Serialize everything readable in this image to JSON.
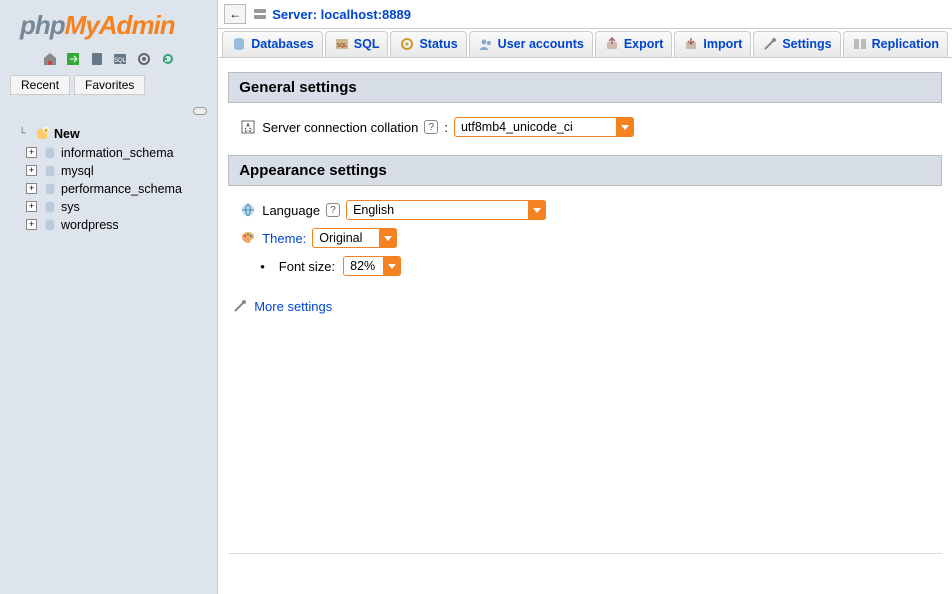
{
  "server": {
    "label": "Server: localhost:8889"
  },
  "sidebar": {
    "tabs": {
      "recent": "Recent",
      "favorites": "Favorites"
    },
    "new_label": "New",
    "databases": [
      {
        "name": "information_schema"
      },
      {
        "name": "mysql"
      },
      {
        "name": "performance_schema"
      },
      {
        "name": "sys"
      },
      {
        "name": "wordpress"
      }
    ]
  },
  "navtabs": [
    {
      "label": "Databases"
    },
    {
      "label": "SQL"
    },
    {
      "label": "Status"
    },
    {
      "label": "User accounts"
    },
    {
      "label": "Export"
    },
    {
      "label": "Import"
    },
    {
      "label": "Settings"
    },
    {
      "label": "Replication"
    }
  ],
  "sections": {
    "general": {
      "title": "General settings",
      "collation_label": "Server connection collation",
      "collation_value": "utf8mb4_unicode_ci"
    },
    "appearance": {
      "title": "Appearance settings",
      "language_label": "Language",
      "language_value": "English",
      "theme_label": "Theme:",
      "theme_value": "Original",
      "fontsize_label": "Font size:",
      "fontsize_value": "82%"
    },
    "more_label": "More settings"
  }
}
